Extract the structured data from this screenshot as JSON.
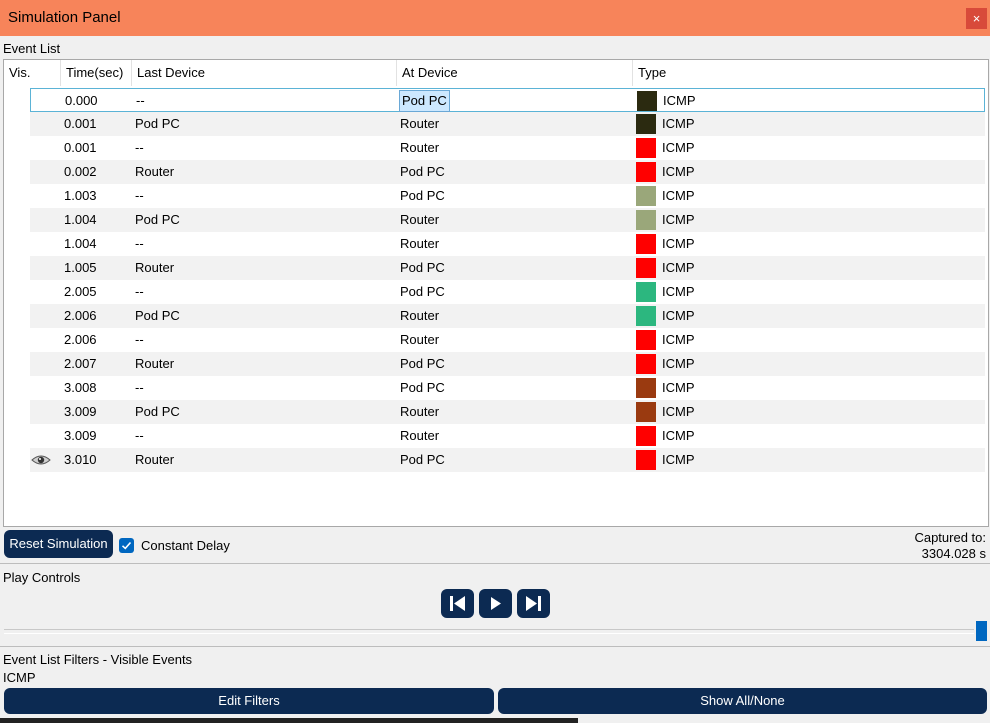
{
  "window": {
    "title": "Simulation Panel",
    "close_glyph": "×"
  },
  "event_list": {
    "label": "Event List",
    "columns": {
      "vis": "Vis.",
      "time": "Time(sec)",
      "last_device": "Last Device",
      "at_device": "At Device",
      "type": "Type"
    },
    "rows": [
      {
        "time": "0.000",
        "last": "--",
        "at": "Pod PC",
        "color": "#2b2a10",
        "type": "ICMP"
      },
      {
        "time": "0.001",
        "last": "Pod PC",
        "at": "Router",
        "color": "#2b2a10",
        "type": "ICMP"
      },
      {
        "time": "0.001",
        "last": "--",
        "at": "Router",
        "color": "#ff0000",
        "type": "ICMP"
      },
      {
        "time": "0.002",
        "last": "Router",
        "at": "Pod PC",
        "color": "#ff0000",
        "type": "ICMP"
      },
      {
        "time": "1.003",
        "last": "--",
        "at": "Pod PC",
        "color": "#9aa77a",
        "type": "ICMP"
      },
      {
        "time": "1.004",
        "last": "Pod PC",
        "at": "Router",
        "color": "#9aa77a",
        "type": "ICMP"
      },
      {
        "time": "1.004",
        "last": "--",
        "at": "Router",
        "color": "#ff0000",
        "type": "ICMP"
      },
      {
        "time": "1.005",
        "last": "Router",
        "at": "Pod PC",
        "color": "#ff0000",
        "type": "ICMP"
      },
      {
        "time": "2.005",
        "last": "--",
        "at": "Pod PC",
        "color": "#2cb77f",
        "type": "ICMP"
      },
      {
        "time": "2.006",
        "last": "Pod PC",
        "at": "Router",
        "color": "#2cb77f",
        "type": "ICMP"
      },
      {
        "time": "2.006",
        "last": "--",
        "at": "Router",
        "color": "#ff0000",
        "type": "ICMP"
      },
      {
        "time": "2.007",
        "last": "Router",
        "at": "Pod PC",
        "color": "#ff0000",
        "type": "ICMP"
      },
      {
        "time": "3.008",
        "last": "--",
        "at": "Pod PC",
        "color": "#9a3a10",
        "type": "ICMP"
      },
      {
        "time": "3.009",
        "last": "Pod PC",
        "at": "Router",
        "color": "#9a3a10",
        "type": "ICMP"
      },
      {
        "time": "3.009",
        "last": "--",
        "at": "Router",
        "color": "#ff0000",
        "type": "ICMP"
      },
      {
        "time": "3.010",
        "last": "Router",
        "at": "Pod PC",
        "color": "#ff0000",
        "type": "ICMP",
        "visible_icon": "eye-icon"
      }
    ]
  },
  "controls": {
    "reset_label": "Reset Simulation",
    "constant_delay_label": "Constant Delay",
    "constant_delay_checked": true,
    "captured_label": "Captured to:",
    "captured_value": "3304.028 s"
  },
  "play_controls": {
    "label": "Play Controls",
    "buttons": [
      "back-step-icon",
      "play-icon",
      "forward-step-icon"
    ],
    "progress": 1.0
  },
  "filters": {
    "label": "Event List Filters - Visible Events",
    "value": "ICMP",
    "edit_label": "Edit Filters",
    "show_all_label": "Show All/None"
  },
  "colors": {
    "titlebar": "#f7845a",
    "accent": "#0c2a52",
    "checkbox": "#0067c0"
  }
}
